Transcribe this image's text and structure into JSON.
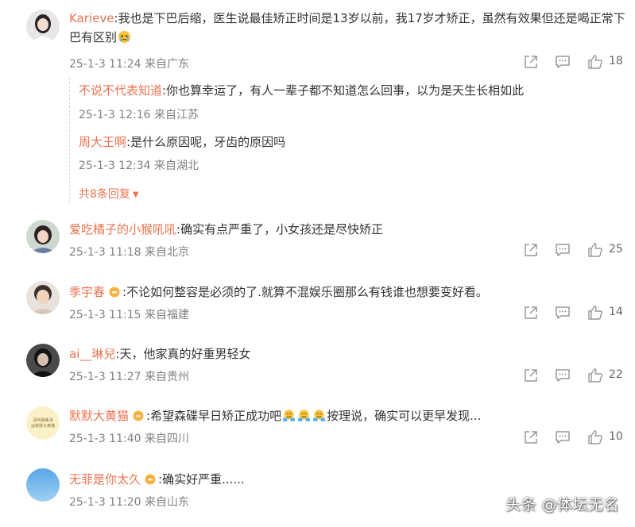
{
  "comments": [
    {
      "user": "Karieve",
      "text": "我也是下巴后缩，医生说最佳矫正时间是13岁以前，我17岁才矫正，虽然有效果但还是喝正常下巴有区别",
      "emoji_icon": "crying-face-emoji",
      "time": "25-1-3 11:24",
      "location": "来自广东",
      "likes": "18"
    },
    {
      "user": "爱吃橘子的小猴吼吼",
      "text": "确实有点严重了，小女孩还是尽快矫正",
      "time": "25-1-3 11:18",
      "location": "来自北京",
      "likes": "25"
    },
    {
      "user": "季宇春",
      "badge_icon": "crown-badge-icon",
      "text": "不论如何整容是必须的了.就算不混娱乐圈那么有钱谁也想要变好看。",
      "time": "25-1-3 11:15",
      "location": "来自福建",
      "likes": "14"
    },
    {
      "user": "ai__琳兒",
      "text": "天，他家真的好重男轻女",
      "time": "25-1-3 11:27",
      "location": "来自贵州",
      "likes": "22"
    },
    {
      "user": "默默大黄猫",
      "badge_icon": "crown-badge-icon",
      "text_before": "希望森碟早日矫正成功吧",
      "emoji_icon": "hugging-face-emoji",
      "text_after": "按理说，确实可以更早发现...",
      "time": "25-1-3 11:40",
      "location": "来自四川",
      "likes": "10",
      "avatar_text": [
        "请叫我美汤",
        "@默默大黄猫"
      ]
    },
    {
      "user": "无菲是你太久",
      "badge_icon": "crown-badge-icon",
      "text": "确实好严重......",
      "time": "25-1-3 11:20",
      "location": "来自山东"
    }
  ],
  "replies": [
    {
      "user": "不说不代表知道",
      "text": "你也算幸运了，有人一辈子都不知道怎么回事，以为是天生长相如此",
      "time": "25-1-3 12:16",
      "location": "来自江苏"
    },
    {
      "user": "周大王啊",
      "text": "是什么原因呢，牙齿的原因吗",
      "time": "25-1-3 12:34",
      "location": "来自湖北"
    }
  ],
  "more_replies_label": "共8条回复",
  "separator": ":",
  "watermark": "头条 @体坛无名",
  "colors": {
    "username": "#eb7350",
    "meta": "#808080",
    "icon": "#999999"
  }
}
